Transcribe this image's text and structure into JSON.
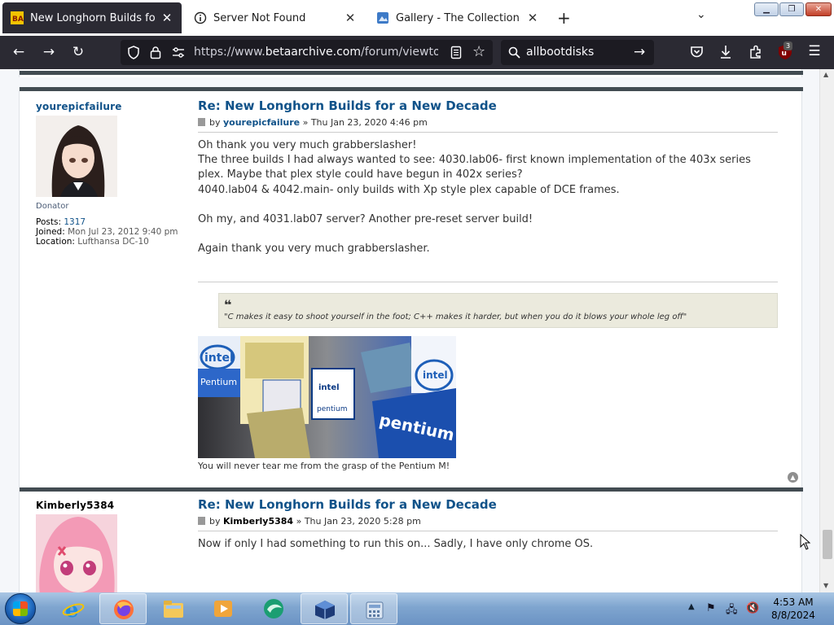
{
  "browser": {
    "tabs": [
      {
        "title": "New Longhorn Builds for a New Decade",
        "active": true
      },
      {
        "title": "Server Not Found",
        "active": false
      },
      {
        "title": "Gallery - The Collection Book",
        "active": false
      }
    ],
    "url_prefix": "https://www.",
    "url_domain": "betaarchive.com",
    "url_path": "/forum/viewtopic.php",
    "search_query": "allbootdisks",
    "ublock_count": "3"
  },
  "posts": [
    {
      "author": "yourepicfailure",
      "rank": "Donator",
      "posts_label": "Posts:",
      "posts_count": "1317",
      "joined_label": "Joined:",
      "joined": "Mon Jul 23, 2012 9:40 pm",
      "location_label": "Location:",
      "location": "Lufthansa DC-10",
      "title": "Re: New Longhorn Builds for a New Decade",
      "by": "by",
      "sep": "»",
      "date": "Thu Jan 23, 2020 4:46 pm",
      "lines": [
        "Oh thank you very much grabberslasher!",
        "The three builds I had always wanted to see: 4030.lab06- first known implementation of the 403x series",
        "plex. Maybe that plex style could have begun in 402x series?",
        "4040.lab04 & 4042.main- only builds with Xp style plex capable of DCE frames.",
        "",
        "Oh my, and 4031.lab07 server? Another pre-reset server build!",
        "",
        "Again thank you very much grabberslasher."
      ],
      "quote": "\"C makes it easy to shoot yourself in the foot; C++ makes it harder, but when you do it blows your whole leg off\"",
      "banner_caption": "You will never tear me from the grasp of the Pentium M!"
    },
    {
      "author": "Kimberly5384",
      "title": "Re: New Longhorn Builds for a New Decade",
      "by": "by",
      "sep": "»",
      "date": "Thu Jan 23, 2020 5:28 pm",
      "lines": [
        "Now if only I had something to run this on... Sadly, I have only chrome OS."
      ]
    }
  ],
  "taskbar": {
    "time": "4:53 AM",
    "date": "8/8/2024"
  }
}
